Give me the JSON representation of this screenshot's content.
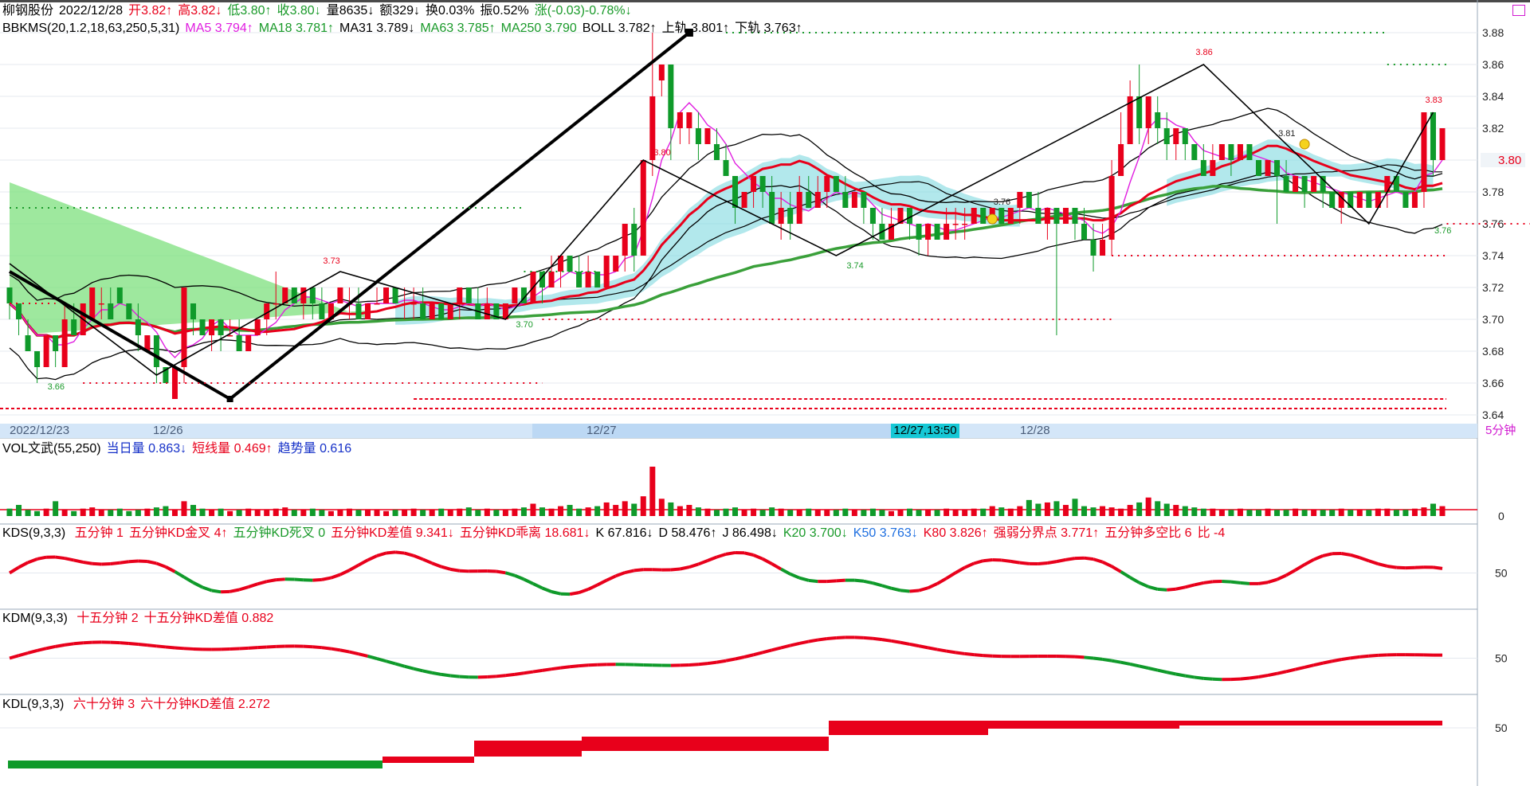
{
  "header": {
    "stock_name": "柳钢股份",
    "date": "2022/12/28",
    "open": "开3.82↑",
    "high": "高3.82↓",
    "low": "低3.80↑",
    "close": "收3.80↓",
    "volume": "量8635↓",
    "amount": "额329↓",
    "turnover": "换0.03%",
    "amplitude": "振0.52%",
    "change": "涨(-0.03)-0.78%↓"
  },
  "main_indicator": {
    "name": "BBKMS(20,1.2,18,63,250,5,31)",
    "ma5": "MA5 3.794↑",
    "ma18": "MA18 3.781↑",
    "ma31": "MA31 3.789↓",
    "ma63": "MA63 3.785↑",
    "ma250": "MA250 3.790",
    "boll": "BOLL 3.782↑",
    "upper": "上轨 3.801↑",
    "lower": "下轨 3.763↑"
  },
  "price_axis": [
    "3.88",
    "3.86",
    "3.84",
    "3.82",
    "3.80",
    "3.78",
    "3.76",
    "3.74",
    "3.72",
    "3.70",
    "3.68",
    "3.66",
    "3.64"
  ],
  "current_price_label": "3.80",
  "peak_labels": [
    "3.86",
    "3.83",
    "3.80",
    "3.81",
    "3.76",
    "3.73",
    "3.66",
    "3.70",
    "3.74",
    "3.76"
  ],
  "date_axis": {
    "labels": [
      "2022/12/23",
      "12/26",
      "12/27",
      "12/28"
    ],
    "cursor": "12/27,13:50",
    "period": "5分钟"
  },
  "vol_panel": {
    "name": "VOL文武(55,250)",
    "daily": "当日量 0.863↓",
    "short": "短线量 0.469↑",
    "trend": "趋势量 0.616",
    "axis": [
      "0"
    ]
  },
  "kds_panel": {
    "name": "KDS(9,3,3)",
    "items": [
      {
        "text": "五分钟 1",
        "color": "red"
      },
      {
        "text": "五分钟KD金叉 4↑",
        "color": "red"
      },
      {
        "text": "五分钟KD死叉 0",
        "color": "green"
      },
      {
        "text": "五分钟KD差值 9.341↓",
        "color": "red"
      },
      {
        "text": "五分钟KD乖离 18.681↓",
        "color": "red"
      },
      {
        "text": "K 67.816↓",
        "color": "black"
      },
      {
        "text": "D 58.476↑",
        "color": "black"
      },
      {
        "text": "J 86.498↓",
        "color": "black"
      },
      {
        "text": "K20 3.700↓",
        "color": "green"
      },
      {
        "text": "K50 3.763↓",
        "color": "lblue"
      },
      {
        "text": "K80 3.826↑",
        "color": "red"
      },
      {
        "text": "强弱分界点 3.771↑",
        "color": "red"
      },
      {
        "text": "五分钟多空比 6",
        "color": "red"
      },
      {
        "text": "比 -4",
        "color": "red"
      }
    ],
    "axis": [
      "50"
    ]
  },
  "kdm_panel": {
    "name": "KDM(9,3,3)",
    "items": [
      {
        "text": "十五分钟 2",
        "color": "red"
      },
      {
        "text": "十五分钟KD差值 0.882",
        "color": "red"
      }
    ],
    "axis": [
      "50"
    ]
  },
  "kdl_panel": {
    "name": "KDL(9,3,3)",
    "items": [
      {
        "text": "六十分钟 3",
        "color": "red"
      },
      {
        "text": "六十分钟KD差值 2.272",
        "color": "red"
      }
    ],
    "axis": [
      "50"
    ]
  },
  "chart_data": {
    "type": "candlestick",
    "ylim": [
      3.64,
      3.89
    ],
    "candles": [
      [
        3.72,
        3.71,
        3.72,
        3.7
      ],
      [
        3.71,
        3.7,
        3.71,
        3.69
      ],
      [
        3.69,
        3.68,
        3.7,
        3.68
      ],
      [
        3.68,
        3.67,
        3.68,
        3.66
      ],
      [
        3.67,
        3.69,
        3.69,
        3.67
      ],
      [
        3.69,
        3.68,
        3.69,
        3.67
      ],
      [
        3.67,
        3.7,
        3.71,
        3.67
      ],
      [
        3.7,
        3.69,
        3.71,
        3.69
      ],
      [
        3.69,
        3.71,
        3.71,
        3.69
      ],
      [
        3.7,
        3.72,
        3.72,
        3.7
      ],
      [
        3.71,
        3.71,
        3.72,
        3.7
      ],
      [
        3.71,
        3.7,
        3.72,
        3.7
      ],
      [
        3.72,
        3.71,
        3.72,
        3.71
      ],
      [
        3.71,
        3.7,
        3.71,
        3.7
      ],
      [
        3.7,
        3.69,
        3.71,
        3.68
      ],
      [
        3.68,
        3.69,
        3.69,
        3.68
      ],
      [
        3.69,
        3.67,
        3.69,
        3.66
      ],
      [
        3.67,
        3.66,
        3.67,
        3.66
      ],
      [
        3.65,
        3.67,
        3.67,
        3.65
      ],
      [
        3.67,
        3.72,
        3.72,
        3.66
      ],
      [
        3.71,
        3.7,
        3.71,
        3.69
      ],
      [
        3.7,
        3.69,
        3.7,
        3.69
      ],
      [
        3.69,
        3.7,
        3.7,
        3.68
      ],
      [
        3.7,
        3.69,
        3.7,
        3.68
      ],
      [
        3.69,
        3.69,
        3.7,
        3.69
      ],
      [
        3.69,
        3.68,
        3.7,
        3.68
      ],
      [
        3.68,
        3.69,
        3.69,
        3.68
      ],
      [
        3.69,
        3.7,
        3.7,
        3.69
      ],
      [
        3.7,
        3.71,
        3.71,
        3.69
      ],
      [
        3.71,
        3.71,
        3.73,
        3.7
      ],
      [
        3.71,
        3.72,
        3.72,
        3.71
      ],
      [
        3.72,
        3.71,
        3.72,
        3.71
      ],
      [
        3.71,
        3.72,
        3.72,
        3.7
      ],
      [
        3.72,
        3.71,
        3.72,
        3.7
      ],
      [
        3.71,
        3.7,
        3.72,
        3.7
      ],
      [
        3.7,
        3.71,
        3.71,
        3.7
      ],
      [
        3.71,
        3.72,
        3.72,
        3.71
      ],
      [
        3.71,
        3.71,
        3.72,
        3.7
      ],
      [
        3.71,
        3.7,
        3.72,
        3.7
      ],
      [
        3.7,
        3.71,
        3.71,
        3.7
      ],
      [
        3.71,
        3.71,
        3.72,
        3.71
      ],
      [
        3.71,
        3.72,
        3.72,
        3.71
      ],
      [
        3.72,
        3.71,
        3.72,
        3.71
      ],
      [
        3.71,
        3.71,
        3.72,
        3.7
      ],
      [
        3.71,
        3.71,
        3.72,
        3.7
      ],
      [
        3.71,
        3.7,
        3.72,
        3.7
      ],
      [
        3.7,
        3.71,
        3.71,
        3.7
      ],
      [
        3.71,
        3.7,
        3.71,
        3.7
      ],
      [
        3.7,
        3.71,
        3.71,
        3.7
      ],
      [
        3.71,
        3.72,
        3.72,
        3.7
      ],
      [
        3.72,
        3.71,
        3.72,
        3.71
      ],
      [
        3.71,
        3.7,
        3.72,
        3.7
      ],
      [
        3.7,
        3.71,
        3.72,
        3.7
      ],
      [
        3.71,
        3.7,
        3.71,
        3.7
      ],
      [
        3.7,
        3.71,
        3.71,
        3.7
      ],
      [
        3.71,
        3.72,
        3.72,
        3.71
      ],
      [
        3.72,
        3.71,
        3.72,
        3.71
      ],
      [
        3.71,
        3.73,
        3.73,
        3.71
      ],
      [
        3.73,
        3.72,
        3.73,
        3.71
      ],
      [
        3.72,
        3.73,
        3.74,
        3.72
      ],
      [
        3.73,
        3.74,
        3.74,
        3.72
      ],
      [
        3.74,
        3.73,
        3.74,
        3.73
      ],
      [
        3.73,
        3.72,
        3.74,
        3.72
      ],
      [
        3.72,
        3.73,
        3.74,
        3.72
      ],
      [
        3.73,
        3.72,
        3.73,
        3.72
      ],
      [
        3.72,
        3.74,
        3.74,
        3.72
      ],
      [
        3.73,
        3.74,
        3.74,
        3.73
      ],
      [
        3.74,
        3.76,
        3.76,
        3.73
      ],
      [
        3.76,
        3.74,
        3.77,
        3.73
      ],
      [
        3.74,
        3.8,
        3.8,
        3.74
      ],
      [
        3.8,
        3.84,
        3.88,
        3.79
      ],
      [
        3.85,
        3.86,
        3.86,
        3.84
      ],
      [
        3.86,
        3.82,
        3.86,
        3.8
      ],
      [
        3.82,
        3.83,
        3.83,
        3.81
      ],
      [
        3.82,
        3.83,
        3.83,
        3.81
      ],
      [
        3.82,
        3.81,
        3.83,
        3.8
      ],
      [
        3.81,
        3.82,
        3.82,
        3.81
      ],
      [
        3.81,
        3.8,
        3.82,
        3.8
      ],
      [
        3.8,
        3.79,
        3.81,
        3.79
      ],
      [
        3.79,
        3.77,
        3.79,
        3.76
      ],
      [
        3.77,
        3.78,
        3.78,
        3.77
      ],
      [
        3.78,
        3.79,
        3.79,
        3.77
      ],
      [
        3.79,
        3.78,
        3.79,
        3.77
      ],
      [
        3.78,
        3.76,
        3.79,
        3.76
      ],
      [
        3.76,
        3.77,
        3.78,
        3.75
      ],
      [
        3.77,
        3.76,
        3.78,
        3.75
      ],
      [
        3.76,
        3.78,
        3.79,
        3.76
      ],
      [
        3.78,
        3.77,
        3.79,
        3.77
      ],
      [
        3.77,
        3.78,
        3.79,
        3.77
      ],
      [
        3.78,
        3.79,
        3.79,
        3.77
      ],
      [
        3.79,
        3.78,
        3.79,
        3.78
      ],
      [
        3.78,
        3.77,
        3.79,
        3.77
      ],
      [
        3.77,
        3.78,
        3.78,
        3.77
      ],
      [
        3.78,
        3.77,
        3.78,
        3.76
      ],
      [
        3.77,
        3.76,
        3.77,
        3.75
      ],
      [
        3.76,
        3.75,
        3.77,
        3.75
      ],
      [
        3.75,
        3.76,
        3.77,
        3.75
      ],
      [
        3.76,
        3.77,
        3.77,
        3.76
      ],
      [
        3.77,
        3.76,
        3.77,
        3.75
      ],
      [
        3.76,
        3.75,
        3.76,
        3.74
      ],
      [
        3.75,
        3.76,
        3.76,
        3.74
      ],
      [
        3.76,
        3.75,
        3.76,
        3.75
      ],
      [
        3.75,
        3.76,
        3.77,
        3.75
      ],
      [
        3.76,
        3.76,
        3.77,
        3.75
      ],
      [
        3.76,
        3.76,
        3.77,
        3.75
      ],
      [
        3.76,
        3.77,
        3.77,
        3.76
      ],
      [
        3.77,
        3.76,
        3.77,
        3.76
      ],
      [
        3.76,
        3.77,
        3.77,
        3.76
      ],
      [
        3.77,
        3.76,
        3.77,
        3.76
      ],
      [
        3.76,
        3.77,
        3.77,
        3.76
      ],
      [
        3.77,
        3.78,
        3.78,
        3.76
      ],
      [
        3.78,
        3.77,
        3.78,
        3.77
      ],
      [
        3.77,
        3.76,
        3.78,
        3.76
      ],
      [
        3.76,
        3.77,
        3.77,
        3.75
      ],
      [
        3.77,
        3.76,
        3.77,
        3.69
      ],
      [
        3.76,
        3.77,
        3.77,
        3.76
      ],
      [
        3.77,
        3.76,
        3.77,
        3.75
      ],
      [
        3.76,
        3.75,
        3.77,
        3.75
      ],
      [
        3.75,
        3.74,
        3.76,
        3.73
      ],
      [
        3.74,
        3.75,
        3.76,
        3.74
      ],
      [
        3.75,
        3.79,
        3.8,
        3.74
      ],
      [
        3.79,
        3.81,
        3.83,
        3.79
      ],
      [
        3.81,
        3.84,
        3.85,
        3.81
      ],
      [
        3.84,
        3.82,
        3.86,
        3.81
      ],
      [
        3.82,
        3.84,
        3.84,
        3.81
      ],
      [
        3.83,
        3.82,
        3.84,
        3.81
      ],
      [
        3.82,
        3.81,
        3.83,
        3.8
      ],
      [
        3.81,
        3.82,
        3.82,
        3.8
      ],
      [
        3.82,
        3.81,
        3.82,
        3.8
      ],
      [
        3.81,
        3.8,
        3.81,
        3.8
      ],
      [
        3.8,
        3.79,
        3.81,
        3.79
      ],
      [
        3.79,
        3.8,
        3.81,
        3.79
      ],
      [
        3.8,
        3.81,
        3.81,
        3.8
      ],
      [
        3.81,
        3.8,
        3.81,
        3.79
      ],
      [
        3.8,
        3.81,
        3.81,
        3.8
      ],
      [
        3.81,
        3.8,
        3.81,
        3.8
      ],
      [
        3.8,
        3.79,
        3.8,
        3.79
      ],
      [
        3.79,
        3.8,
        3.8,
        3.79
      ],
      [
        3.8,
        3.79,
        3.8,
        3.76
      ],
      [
        3.79,
        3.78,
        3.8,
        3.78
      ],
      [
        3.78,
        3.79,
        3.79,
        3.78
      ],
      [
        3.79,
        3.78,
        3.79,
        3.77
      ],
      [
        3.78,
        3.79,
        3.79,
        3.78
      ],
      [
        3.79,
        3.78,
        3.79,
        3.77
      ],
      [
        3.78,
        3.77,
        3.78,
        3.77
      ],
      [
        3.77,
        3.78,
        3.78,
        3.76
      ],
      [
        3.78,
        3.77,
        3.78,
        3.77
      ],
      [
        3.77,
        3.78,
        3.78,
        3.77
      ],
      [
        3.78,
        3.77,
        3.78,
        3.77
      ],
      [
        3.77,
        3.78,
        3.78,
        3.77
      ],
      [
        3.78,
        3.79,
        3.79,
        3.77
      ],
      [
        3.79,
        3.78,
        3.79,
        3.78
      ],
      [
        3.78,
        3.77,
        3.78,
        3.77
      ],
      [
        3.77,
        3.78,
        3.78,
        3.77
      ],
      [
        3.78,
        3.83,
        3.83,
        3.77
      ],
      [
        3.83,
        3.8,
        3.83,
        3.79
      ],
      [
        3.8,
        3.82,
        3.82,
        3.8
      ]
    ],
    "volume": [
      6,
      9,
      5,
      4,
      6,
      12,
      5,
      4,
      6,
      7,
      5,
      5,
      6,
      4,
      5,
      6,
      7,
      8,
      5,
      12,
      9,
      6,
      5,
      6,
      4,
      5,
      6,
      5,
      5,
      6,
      7,
      5,
      5,
      6,
      5,
      4,
      5,
      6,
      5,
      5,
      5,
      4,
      5,
      5,
      6,
      5,
      5,
      6,
      5,
      6,
      7,
      5,
      6,
      5,
      5,
      6,
      7,
      10,
      7,
      6,
      8,
      9,
      6,
      7,
      8,
      11,
      9,
      12,
      10,
      16,
      40,
      14,
      11,
      8,
      9,
      7,
      6,
      5,
      6,
      7,
      5,
      6,
      5,
      7,
      6,
      5,
      5,
      6,
      5,
      5,
      5,
      6,
      5,
      5,
      6,
      5,
      4,
      5,
      6,
      5,
      5,
      5,
      6,
      5,
      5,
      6,
      6,
      8,
      7,
      6,
      8,
      13,
      10,
      11,
      12,
      9,
      14,
      8,
      7,
      8,
      7,
      6,
      9,
      11,
      15,
      12,
      10,
      9,
      8,
      7,
      6,
      6,
      5,
      5,
      6,
      5,
      5,
      6,
      5,
      5,
      6,
      5,
      5,
      5,
      5,
      6,
      5,
      5,
      5,
      6,
      6,
      5,
      5,
      6,
      7,
      10,
      8
    ]
  }
}
